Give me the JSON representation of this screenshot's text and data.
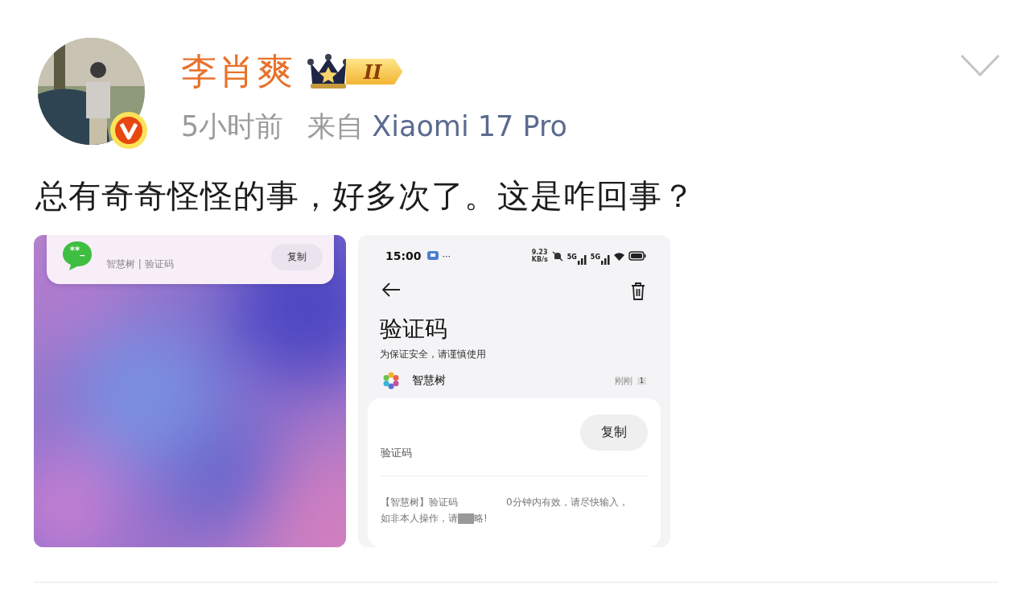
{
  "post": {
    "author": "李肖爽",
    "badge_level": "II",
    "time": "5小时前",
    "source_prefix": "来自",
    "source_device": "Xiaomi 17 Pro",
    "text": "总有奇奇怪怪的事，好多次了。这是咋回事？"
  },
  "images": [
    {
      "kind": "wallpaper",
      "notification": {
        "icon_text": "**_",
        "sender_line": "智慧树 | 验证码",
        "button": "复制"
      }
    },
    {
      "kind": "sms",
      "status_bar": {
        "time": "15:00",
        "more": "···",
        "speed_value": "9.23",
        "speed_unit": "KB/s",
        "sim_labels": [
          "5G",
          "5G"
        ]
      },
      "title": "验证码",
      "subtitle": "为保证安全，请谨慎使用",
      "sender": "智慧树",
      "timestamp": "刚刚",
      "unread": "1",
      "card": {
        "button": "复制",
        "label": "验证码",
        "message_parts": [
          "【智慧树】验证码",
          "0分钟内有效，请尽快输入，",
          "如非本人操作，请",
          "略!"
        ]
      }
    }
  ]
}
